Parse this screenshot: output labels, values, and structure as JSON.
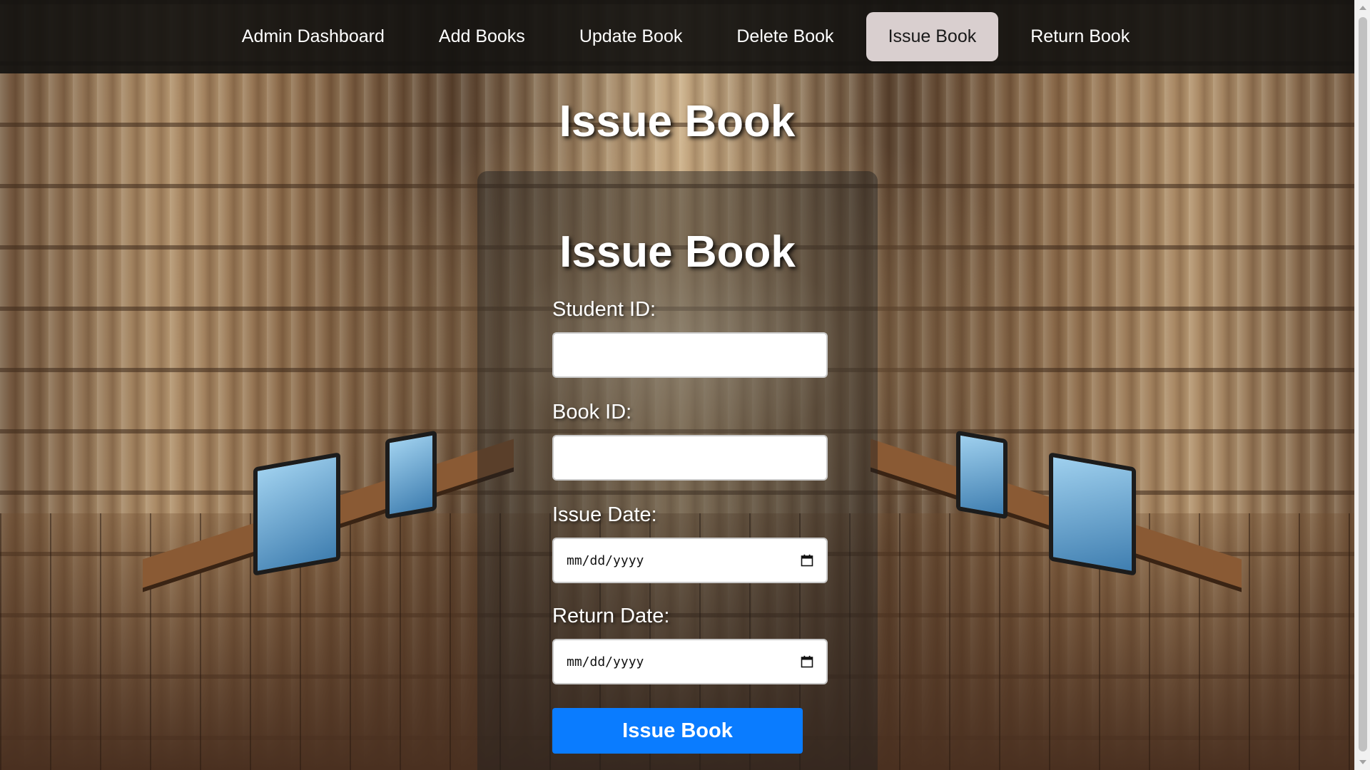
{
  "nav": {
    "items": [
      {
        "label": "Admin Dashboard",
        "active": false
      },
      {
        "label": "Add Books",
        "active": false
      },
      {
        "label": "Update Book",
        "active": false
      },
      {
        "label": "Delete Book",
        "active": false
      },
      {
        "label": "Issue Book",
        "active": true
      },
      {
        "label": "Return Book",
        "active": false
      }
    ]
  },
  "page": {
    "title": "Issue Book"
  },
  "form": {
    "title": "Issue Book",
    "student_id": {
      "label": "Student ID:",
      "value": ""
    },
    "book_id": {
      "label": "Book ID:",
      "value": ""
    },
    "issue_date": {
      "label": "Issue Date:",
      "placeholder": "mm/dd/yyyy"
    },
    "return_date": {
      "label": "Return Date:",
      "placeholder": "mm/dd/yyyy"
    },
    "submit_label": "Issue Book"
  },
  "colors": {
    "nav_background": "#141210",
    "nav_active_background": "#d9cfcf",
    "submit_button": "#0a7cff"
  },
  "icons": {
    "date_picker": "calendar-icon"
  }
}
